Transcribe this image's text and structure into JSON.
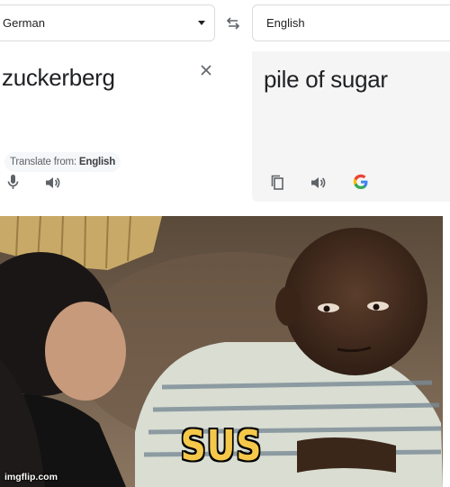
{
  "translator": {
    "source_language": "German",
    "target_language": "English",
    "source_text": "zuckerberg",
    "translated_text": "pile of sugar",
    "detect_label": "Translate from:",
    "detect_language": "English",
    "icons": {
      "dropdown": "chevron-down-icon",
      "swap": "swap-icon",
      "clear": "close-icon",
      "mic": "microphone-icon",
      "speaker": "speaker-icon",
      "copy": "copy-icon",
      "google": "google-logo-icon"
    }
  },
  "meme": {
    "caption": "SUS",
    "watermark": "imgflip.com",
    "caption_color": "#f5c84a"
  }
}
